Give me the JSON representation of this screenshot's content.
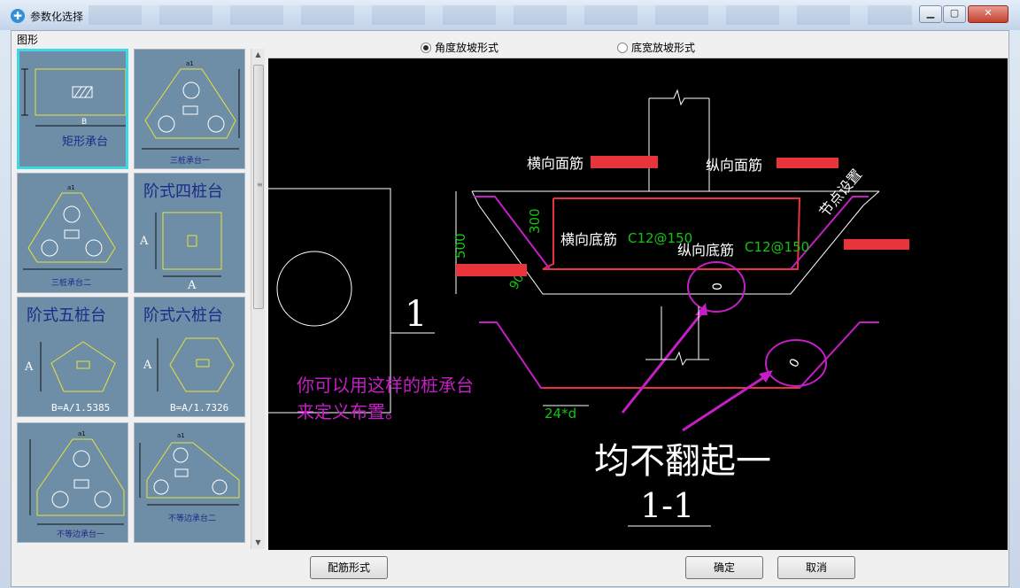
{
  "window": {
    "title": "参数化选择",
    "app_icon": "cad-app-icon"
  },
  "panel": {
    "label": "图形",
    "thumbnails": [
      {
        "caption": "矩形承台",
        "dim": "B"
      },
      {
        "caption": "三桩承台一",
        "dim": "a1"
      },
      {
        "caption": "三桩承台二",
        "dim": "a1"
      },
      {
        "caption": "阶式四桩台",
        "dim": "A"
      },
      {
        "caption": "阶式五桩台",
        "dim": "A",
        "formula": "B=A/1.5385"
      },
      {
        "caption": "阶式六桩台",
        "dim": "A",
        "formula": "B=A/1.7326"
      },
      {
        "caption": "不等边承台一",
        "dim": "a1"
      },
      {
        "caption": "不等边承台二",
        "dim": "a1"
      }
    ]
  },
  "options": {
    "angle_slope": "角度放坡形式",
    "width_slope": "底宽放坡形式",
    "selected": "angle_slope"
  },
  "drawing": {
    "labels": {
      "transverse_top": "横向面筋",
      "longitudinal_top": "纵向面筋",
      "node_setting": "节点设置",
      "transverse_bottom": "横向底筋",
      "transverse_bottom_spec": "C12@150",
      "longitudinal_bottom": "纵向底筋",
      "longitudinal_bottom_spec": "C12@150",
      "dim_300": "300",
      "dim_500": "500",
      "angle_90": "90",
      "dim_24d": "24*d",
      "zero_a": "0",
      "zero_b": "0",
      "section_mark": "1",
      "hint_line1": "你可以用这样的桩承台",
      "hint_line2": "来定义布置。",
      "note": "均不翻起一",
      "section_title": "1-1"
    },
    "colors": {
      "rebar": "#e8343a",
      "dim": "#12c612",
      "hint": "#c51ec5",
      "outline": "#ffffff"
    }
  },
  "buttons": {
    "rebar_form": "配筋形式",
    "ok": "确定",
    "cancel": "取消"
  }
}
